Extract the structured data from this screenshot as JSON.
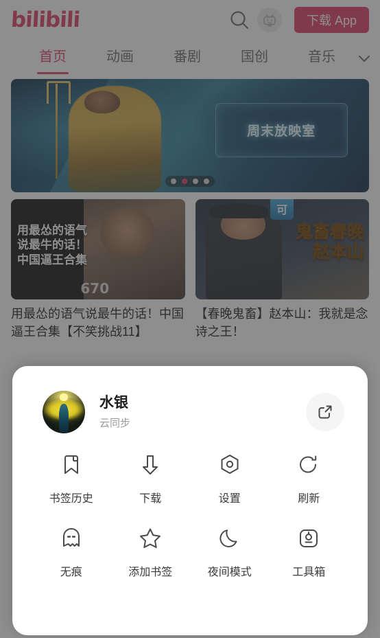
{
  "header": {
    "logo_text": "bilibili",
    "logo_color": "#e0385f",
    "search_icon": "search-icon",
    "tv_icon": "tv-mascot-icon",
    "download_app_label": "下载 App",
    "download_app_color": "#e0385f"
  },
  "nav": {
    "tabs": [
      {
        "label": "首页",
        "active": true
      },
      {
        "label": "动画",
        "active": false
      },
      {
        "label": "番剧",
        "active": false
      },
      {
        "label": "国创",
        "active": false
      },
      {
        "label": "音乐",
        "active": false
      }
    ],
    "more_icon": "chevron-down-icon",
    "active_color": "#e0385f"
  },
  "banner": {
    "plaque_text": "周末放映室",
    "dots_total": 4,
    "active_dot_index": 1,
    "active_dot_color": "#e0385f"
  },
  "cards": [
    {
      "thumb_text_line1": "用最怂的语气",
      "thumb_text_line2": "说最牛的话！",
      "thumb_text_line3": "中国逼王合集",
      "thumb_number": "670",
      "title": "用最怂的语气说最牛的话！中国逼王合集【不笑挑战11】"
    },
    {
      "thumb_tag": "可",
      "thumb_text_line1": "鬼畜春晚",
      "thumb_text_line2": "赵本山",
      "title": "【春晚鬼畜】赵本山：我就是念诗之王！"
    }
  ],
  "sheet": {
    "profile": {
      "avatar_icon": "user-avatar",
      "name": "水银",
      "subtitle": "云同步",
      "share_icon": "share-external-icon"
    },
    "actions": [
      {
        "icon": "bookmark-history-icon",
        "label": "书签历史"
      },
      {
        "icon": "download-arrow-icon",
        "label": "下载"
      },
      {
        "icon": "settings-hexagon-icon",
        "label": "设置"
      },
      {
        "icon": "refresh-icon",
        "label": "刷新"
      },
      {
        "icon": "incognito-ghost-icon",
        "label": "无痕"
      },
      {
        "icon": "star-add-bookmark-icon",
        "label": "添加书签"
      },
      {
        "icon": "moon-night-mode-icon",
        "label": "夜间模式"
      },
      {
        "icon": "toolbox-icon",
        "label": "工具箱"
      }
    ]
  }
}
